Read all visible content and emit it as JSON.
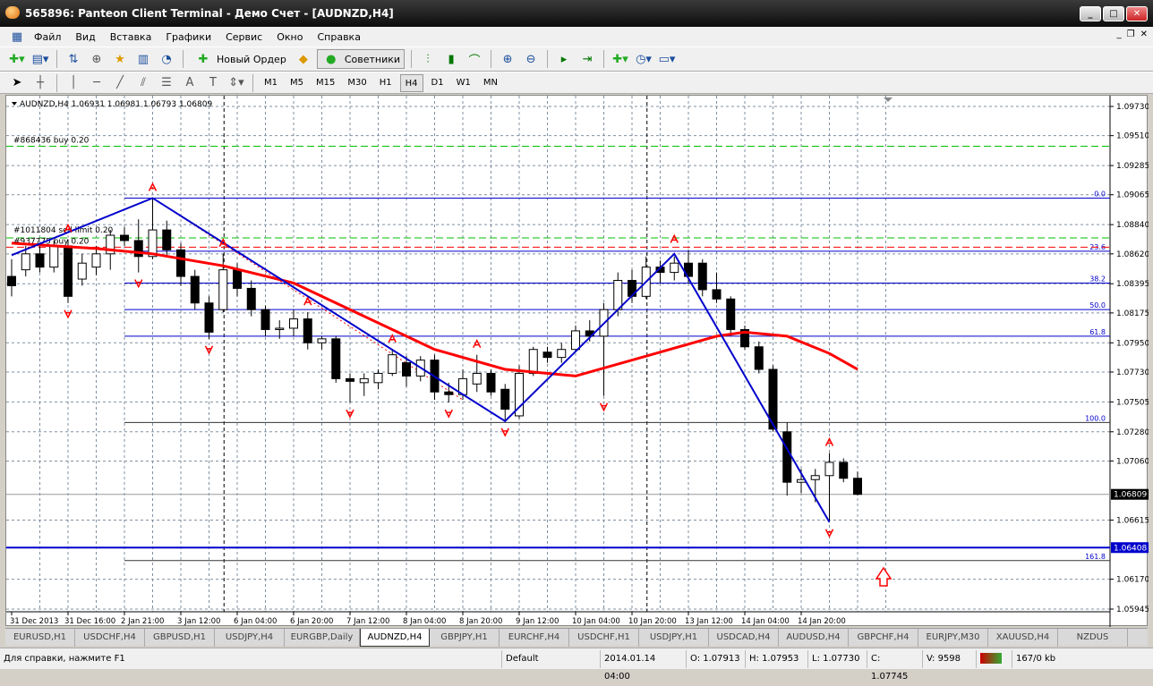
{
  "window": {
    "title": "565896: Panteon Client Terminal - Демо Счет - [AUDNZD,H4]"
  },
  "menu": [
    "Файл",
    "Вид",
    "Вставка",
    "Графики",
    "Сервис",
    "Окно",
    "Справка"
  ],
  "toolbar": {
    "new_order": "Новый Ордер",
    "experts": "Советники"
  },
  "timeframes": [
    "M1",
    "M5",
    "M15",
    "M30",
    "H1",
    "H4",
    "D1",
    "W1",
    "MN"
  ],
  "active_timeframe": "H4",
  "chart": {
    "header": "AUDNZD,H4  1.06931 1.06981 1.06793 1.06809",
    "symbol": "AUDNZD",
    "timeframe": "H4",
    "current_price": "1.06809",
    "line_price_label": "1.06408",
    "price_ticks": [
      "1.09730",
      "1.09510",
      "1.09285",
      "1.09065",
      "1.08840",
      "1.08620",
      "1.08395",
      "1.08175",
      "1.07950",
      "1.07730",
      "1.07505",
      "1.07280",
      "1.07060",
      "1.06615",
      "1.06170",
      "1.05945"
    ],
    "time_labels": [
      "31 Dec 2013",
      "31 Dec 16:00",
      "2 Jan 21:00",
      "3 Jan 12:00",
      "6 Jan 04:00",
      "6 Jan 20:00",
      "7 Jan 12:00",
      "8 Jan 04:00",
      "8 Jan 20:00",
      "9 Jan 12:00",
      "10 Jan 04:00",
      "10 Jan 20:00",
      "13 Jan 12:00",
      "14 Jan 04:00",
      "14 Jan 20:00"
    ],
    "orders": [
      {
        "label": "#868436 buy 0.20",
        "price": 1.0943,
        "color": "#00c000"
      },
      {
        "label": "#1011804 sell limit 0.20",
        "price": 1.0874,
        "color": "#00c000"
      },
      {
        "label": "#937775 buy 0.20",
        "price": 1.0867,
        "color": "#ff0000"
      }
    ],
    "fibo": [
      {
        "level": "0.0",
        "price": 1.0904
      },
      {
        "level": "23.6",
        "price": 1.0864
      },
      {
        "level": "38.2",
        "price": 1.084
      },
      {
        "level": "50.0",
        "price": 1.082
      },
      {
        "level": "61.8",
        "price": 1.08
      },
      {
        "level": "100.0",
        "price": 1.0735
      },
      {
        "level": "161.8",
        "price": 1.0631
      }
    ],
    "horizontal_line": 1.06408,
    "colors": {
      "bull": "#ffffff",
      "bear": "#000000",
      "ma": "#ff0000",
      "zigzag": "#0000cc",
      "grid": "#8090a0",
      "fractal": "#ff0000"
    },
    "candles": [
      [
        1.0845,
        1.0858,
        1.083,
        1.0838
      ],
      [
        1.085,
        1.0868,
        1.0845,
        1.0862
      ],
      [
        1.0862,
        1.087,
        1.0848,
        1.0852
      ],
      [
        1.0852,
        1.0872,
        1.0848,
        1.0868
      ],
      [
        1.0868,
        1.0873,
        1.0825,
        1.083
      ],
      [
        1.0843,
        1.0862,
        1.0838,
        1.0855
      ],
      [
        1.0852,
        1.0868,
        1.0846,
        1.0862
      ],
      [
        1.0862,
        1.088,
        1.085,
        1.0876
      ],
      [
        1.0876,
        1.0882,
        1.0868,
        1.0872
      ],
      [
        1.0872,
        1.0888,
        1.0848,
        1.086
      ],
      [
        1.086,
        1.0904,
        1.0858,
        1.088
      ],
      [
        1.088,
        1.0887,
        1.086,
        1.0865
      ],
      [
        1.0865,
        1.087,
        1.0838,
        1.0845
      ],
      [
        1.0845,
        1.085,
        1.082,
        1.0825
      ],
      [
        1.0825,
        1.083,
        1.0798,
        1.0803
      ],
      [
        1.082,
        1.0862,
        1.0818,
        1.085
      ],
      [
        1.085,
        1.0855,
        1.083,
        1.0836
      ],
      [
        1.0836,
        1.0842,
        1.0815,
        1.082
      ],
      [
        1.082,
        1.0823,
        1.08,
        1.0805
      ],
      [
        1.0805,
        1.0812,
        1.0798,
        1.0806
      ],
      [
        1.0806,
        1.082,
        1.08,
        1.0813
      ],
      [
        1.0813,
        1.0818,
        1.079,
        1.0795
      ],
      [
        1.0795,
        1.08,
        1.079,
        1.0798
      ],
      [
        1.0798,
        1.08,
        1.0765,
        1.0768
      ],
      [
        1.0768,
        1.0772,
        1.075,
        1.0766
      ],
      [
        1.0765,
        1.0772,
        1.0755,
        1.0768
      ],
      [
        1.0765,
        1.0775,
        1.076,
        1.0772
      ],
      [
        1.0772,
        1.079,
        1.077,
        1.0786
      ],
      [
        1.078,
        1.0785,
        1.0762,
        1.077
      ],
      [
        1.077,
        1.0785,
        1.0766,
        1.0782
      ],
      [
        1.0782,
        1.0786,
        1.0752,
        1.0758
      ],
      [
        1.0758,
        1.0765,
        1.075,
        1.0756
      ],
      [
        1.0756,
        1.0775,
        1.0752,
        1.0768
      ],
      [
        1.0764,
        1.0786,
        1.0758,
        1.0772
      ],
      [
        1.0772,
        1.0775,
        1.0755,
        1.0758
      ],
      [
        1.076,
        1.0764,
        1.0736,
        1.0745
      ],
      [
        1.074,
        1.0778,
        1.0738,
        1.0772
      ],
      [
        1.0772,
        1.0792,
        1.077,
        1.079
      ],
      [
        1.0788,
        1.0792,
        1.078,
        1.0784
      ],
      [
        1.0784,
        1.0795,
        1.078,
        1.079
      ],
      [
        1.079,
        1.0808,
        1.0788,
        1.0804
      ],
      [
        1.0804,
        1.0812,
        1.0796,
        1.08
      ],
      [
        1.08,
        1.0825,
        1.0755,
        1.082
      ],
      [
        1.082,
        1.0848,
        1.0815,
        1.0842
      ],
      [
        1.0842,
        1.085,
        1.0825,
        1.083
      ],
      [
        1.083,
        1.086,
        1.0828,
        1.0852
      ],
      [
        1.0852,
        1.0857,
        1.084,
        1.0848
      ],
      [
        1.0848,
        1.086,
        1.0842,
        1.0855
      ],
      [
        1.0855,
        1.0865,
        1.084,
        1.0845
      ],
      [
        1.0855,
        1.0858,
        1.083,
        1.0835
      ],
      [
        1.0835,
        1.0848,
        1.0825,
        1.0828
      ],
      [
        1.0828,
        1.083,
        1.08,
        1.0805
      ],
      [
        1.0805,
        1.0808,
        1.079,
        1.0792
      ],
      [
        1.0792,
        1.0796,
        1.0772,
        1.0775
      ],
      [
        1.0775,
        1.0778,
        1.0728,
        1.073
      ],
      [
        1.0728,
        1.0735,
        1.068,
        1.069
      ],
      [
        1.069,
        1.07,
        1.0682,
        1.0692
      ],
      [
        1.0692,
        1.07,
        1.0675,
        1.0695
      ],
      [
        1.0695,
        1.0712,
        1.066,
        1.0705
      ],
      [
        1.0705,
        1.0708,
        1.069,
        1.0693
      ],
      [
        1.0693,
        1.0698,
        1.068,
        1.06809
      ]
    ],
    "ma": [
      [
        0,
        1.087
      ],
      [
        6,
        1.0866
      ],
      [
        10,
        1.0862
      ],
      [
        15,
        1.0853
      ],
      [
        20,
        1.084
      ],
      [
        25,
        1.0815
      ],
      [
        30,
        1.079
      ],
      [
        35,
        1.0775
      ],
      [
        40,
        1.077
      ],
      [
        45,
        1.0785
      ],
      [
        50,
        1.08
      ],
      [
        52,
        1.0803
      ],
      [
        55,
        1.08
      ],
      [
        58,
        1.0787
      ],
      [
        60,
        1.0775
      ]
    ],
    "zigzag": [
      [
        0,
        1.0861
      ],
      [
        10,
        1.0904
      ],
      [
        35,
        1.0736
      ],
      [
        47,
        1.0862
      ],
      [
        58,
        1.066
      ]
    ],
    "fractals_up": [
      [
        10,
        1.0904
      ],
      [
        4,
        1.0873
      ],
      [
        15,
        1.0862
      ],
      [
        21,
        1.0818
      ],
      [
        27,
        1.079
      ],
      [
        33,
        1.0786
      ],
      [
        47,
        1.0865
      ],
      [
        58,
        1.0712
      ]
    ],
    "fractals_down": [
      [
        4,
        1.0825
      ],
      [
        9,
        1.0848
      ],
      [
        14,
        1.0798
      ],
      [
        24,
        1.075
      ],
      [
        31,
        1.075
      ],
      [
        35,
        1.0736
      ],
      [
        42,
        1.0755
      ],
      [
        58,
        1.066
      ]
    ]
  },
  "tabs": [
    "EURUSD,H1",
    "USDCHF,H4",
    "GBPUSD,H1",
    "USDJPY,H4",
    "EURGBP,Daily",
    "AUDNZD,H4",
    "GBPJPY,H1",
    "EURCHF,H4",
    "USDCHF,H1",
    "USDJPY,H1",
    "USDCAD,H4",
    "AUDUSD,H4",
    "GBPCHF,H4",
    "EURJPY,M30",
    "XAUUSD,H4",
    "NZDUS"
  ],
  "active_tab": "AUDNZD,H4",
  "status": {
    "help": "Для справки, нажмите F1",
    "profile": "Default",
    "datetime": "2014.01.14 04:00",
    "open": "O: 1.07913",
    "high": "H: 1.07953",
    "low": "L: 1.07730",
    "close": "C: 1.07745",
    "volume": "V: 9598",
    "traffic": "167/0 kb"
  }
}
